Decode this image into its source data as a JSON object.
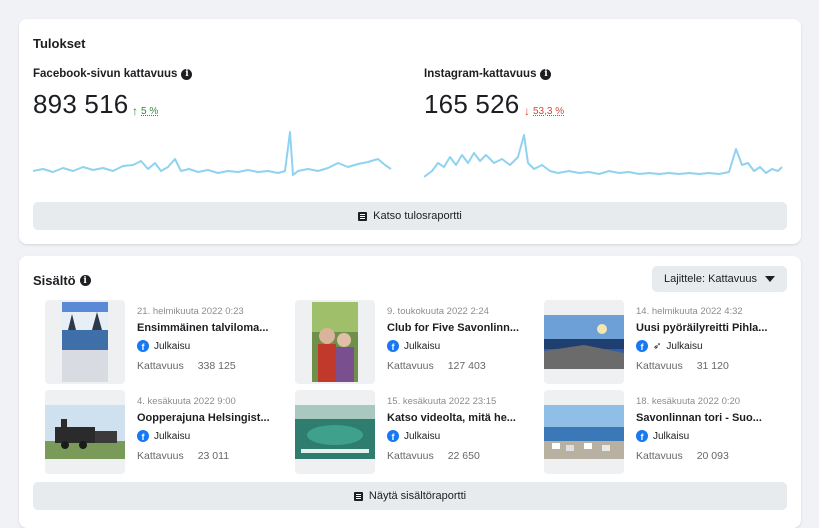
{
  "results": {
    "title": "Tulokset",
    "facebook": {
      "label": "Facebook-sivun kattavuus",
      "value": "893 516",
      "change": "5 %",
      "direction": "up"
    },
    "instagram": {
      "label": "Instagram-kattavuus",
      "value": "165 526",
      "change": "53,3 %",
      "direction": "down"
    },
    "report_button": "Katso tulosraportti"
  },
  "content": {
    "title": "Sisältö",
    "sort_label": "Lajittele: Kattavuus",
    "reach_label": "Kattavuus",
    "posts": [
      {
        "date": "21. helmikuuta 2022 0:23",
        "title": "Ensimmäinen talviloma...",
        "type": "Julkaisu",
        "reach": "338 125",
        "boosted": false
      },
      {
        "date": "9. toukokuuta 2022 2:24",
        "title": "Club for Five Savonlinn...",
        "type": "Julkaisu",
        "reach": "127 403",
        "boosted": false
      },
      {
        "date": "14. helmikuuta 2022 4:32",
        "title": "Uusi pyöräilyreitti Pihla...",
        "type": "Julkaisu",
        "reach": "31 120",
        "boosted": true
      },
      {
        "date": "4. kesäkuuta 2022 9:00",
        "title": "Oopperajuna Helsingist...",
        "type": "Julkaisu",
        "reach": "23 011",
        "boosted": false
      },
      {
        "date": "15. kesäkuuta 2022 23:15",
        "title": "Katso videolta, mitä he...",
        "type": "Julkaisu",
        "reach": "22 650",
        "boosted": false
      },
      {
        "date": "18. kesäkuuta 2022 0:20",
        "title": "Savonlinnan tori - Suo...",
        "type": "Julkaisu",
        "reach": "20 093",
        "boosted": false
      }
    ],
    "report_button": "Näytä sisältöraportti"
  },
  "colors": {
    "sparkline": "#8fd3f0",
    "up": "#2e8b3d",
    "down": "#d9463b",
    "facebook": "#1877f2"
  }
}
